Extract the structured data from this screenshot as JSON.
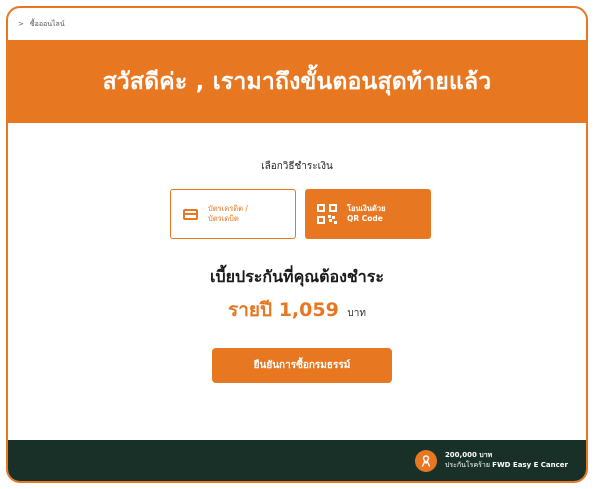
{
  "breadcrumb": {
    "label": "ซื้อออนไลน์"
  },
  "banner": {
    "title": "สวัสดีค่ะ , เรามาถึงขั้นตอนสุดท้ายแล้ว"
  },
  "payment": {
    "title": "เลือกวิธีชำระเงิน",
    "options": [
      {
        "label_line1": "บัตรเครดิต /",
        "label_line2": "บัตรเดบิต",
        "icon": "credit-card-icon",
        "selected": false
      },
      {
        "label_line1": "โอนเงินด้วย",
        "label_line2": "QR Code",
        "icon": "qr-code-icon",
        "selected": true
      }
    ]
  },
  "premium": {
    "title": "เบี้ยประกันที่คุณต้องชำระ",
    "amount_text": "รายปี 1,059",
    "unit": "บาท"
  },
  "confirm_button": {
    "label": "ยืนยันการซื้อกรมธรรม์"
  },
  "footer": {
    "icon": "ribbon-icon",
    "amount": "200,000 บาท",
    "plan_prefix": "ประกันโรคร้าย",
    "plan_name": "FWD Easy E Cancer"
  },
  "colors": {
    "accent": "#e87722",
    "footer_bg": "#183028",
    "white": "#ffffff"
  }
}
